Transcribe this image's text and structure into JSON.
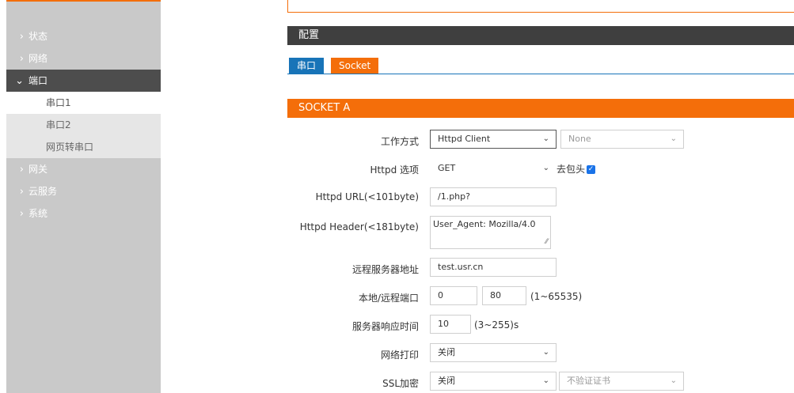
{
  "sidebar": {
    "items": [
      {
        "label": "状态",
        "chevron": "›"
      },
      {
        "label": "网络",
        "chevron": "›"
      },
      {
        "label": "端口",
        "chevron": "⌄"
      },
      {
        "label": "网关",
        "chevron": "›"
      },
      {
        "label": "云服务",
        "chevron": "›"
      },
      {
        "label": "系统",
        "chevron": "›"
      }
    ],
    "subitems": [
      "串口1",
      "串口2",
      "网页转串口"
    ]
  },
  "config_title": "配置",
  "tabs": [
    "串口",
    "Socket"
  ],
  "section_title": "SOCKET A",
  "form": {
    "work_mode": {
      "label": "工作方式",
      "value": "Httpd Client",
      "secondary": "None"
    },
    "httpd_option": {
      "label": "Httpd 选项",
      "value": "GET",
      "strip_header_label": "去包头",
      "strip_header_checked": true
    },
    "httpd_url": {
      "label": "Httpd URL(<101byte)",
      "value": "/1.php?"
    },
    "httpd_header": {
      "label": "Httpd Header(<181byte)",
      "value": "User_Agent: Mozilla/4.0"
    },
    "remote_server": {
      "label": "远程服务器地址",
      "value": "test.usr.cn"
    },
    "ports": {
      "label": "本地/远程端口",
      "local": "0",
      "remote": "80",
      "hint": "(1~65535)"
    },
    "response_time": {
      "label": "服务器响应时间",
      "value": "10",
      "hint": "(3~255)s"
    },
    "net_print": {
      "label": "网络打印",
      "value": "关闭"
    },
    "ssl": {
      "label": "SSL加密",
      "value": "关闭",
      "cert": "不验证证书"
    }
  },
  "colors": {
    "accent": "#f46e0a",
    "tab_blue": "#1874b8",
    "nav_active": "#4d4d4d"
  }
}
